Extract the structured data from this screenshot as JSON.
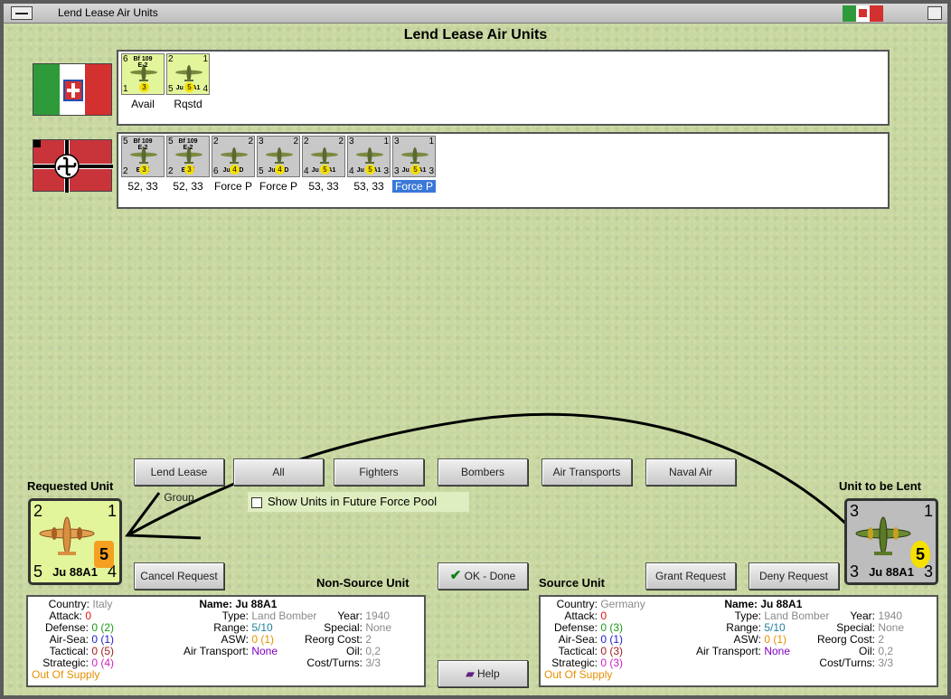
{
  "window": {
    "title": "Lend Lease Air Units"
  },
  "heading": "Lend Lease Air Units",
  "italy_units": [
    {
      "tl": "6",
      "tr": "",
      "bl": "1",
      "br": "",
      "top_name": "Bf 109\nE-2",
      "name": "",
      "str": "3",
      "label": "Avail",
      "bg": "#e3f59b"
    },
    {
      "tl": "2",
      "tr": "1",
      "bl": "5",
      "br": "4",
      "top_name": "",
      "name": "Ju 88A1",
      "str": "5",
      "label": "Rqstd",
      "bg": "#e3f59b"
    }
  ],
  "germany_units": [
    {
      "tl": "5",
      "tr": "",
      "bl": "2",
      "br": "",
      "top_name": "Bf 109\nE-2",
      "name": "Emil",
      "str": "3",
      "label": "52, 33",
      "bg": "#c8c8c8"
    },
    {
      "tl": "5",
      "tr": "",
      "bl": "2",
      "br": "",
      "top_name": "Bf 109\nE-2",
      "name": "Emil",
      "str": "3",
      "label": "52, 33",
      "bg": "#c8c8c8"
    },
    {
      "tl": "2",
      "tr": "2",
      "bl": "6",
      "br": "",
      "top_name": "",
      "name": "Ju 87D",
      "str": "4",
      "label": "Force P",
      "bg": "#c8c8c8"
    },
    {
      "tl": "3",
      "tr": "2",
      "bl": "5",
      "br": "",
      "top_name": "",
      "name": "Ju 87D",
      "str": "4",
      "label": "Force P",
      "bg": "#c8c8c8"
    },
    {
      "tl": "2",
      "tr": "2",
      "bl": "4",
      "br": "",
      "top_name": "",
      "name": "Ju 88A1",
      "str": "5",
      "label": "53, 33",
      "bg": "#c8c8c8"
    },
    {
      "tl": "3",
      "tr": "1",
      "bl": "4",
      "br": "3",
      "top_name": "",
      "name": "Ju 88A1",
      "str": "5",
      "label": "53, 33",
      "bg": "#c8c8c8"
    },
    {
      "tl": "3",
      "tr": "1",
      "bl": "3",
      "br": "3",
      "top_name": "",
      "name": "Ju 88A1",
      "str": "5",
      "label": "Force P",
      "bg": "#c8c8c8",
      "selected": true
    }
  ],
  "buttons": {
    "lend_lease_group": "Lend Lease Group",
    "all": "All",
    "fighters": "Fighters",
    "bombers": "Bombers",
    "air_transports": "Air Transports",
    "naval_air": "Naval Air",
    "cancel_request": "Cancel Request",
    "ok_done": "OK - Done",
    "grant_request": "Grant Request",
    "deny_request": "Deny Request",
    "help": "Help"
  },
  "checkbox": {
    "label": "Show Units in Future Force Pool",
    "checked": false
  },
  "sections": {
    "requested_unit": "Requested Unit",
    "unit_to_be_lent": "Unit to be Lent",
    "non_source_unit": "Non-Source Unit",
    "source_unit": "Source Unit"
  },
  "requested_counter": {
    "tl": "2",
    "tr": "1",
    "bl": "5",
    "br": "4",
    "name": "Ju 88A1",
    "str": "5"
  },
  "lent_counter": {
    "tl": "3",
    "tr": "1",
    "bl": "3",
    "br": "3",
    "name": "Ju 88A1",
    "str": "5"
  },
  "non_source_info": {
    "labels": {
      "country": "Country:",
      "attack": "Attack:",
      "defense": "Defense:",
      "air_sea": "Air-Sea:",
      "tactical": "Tactical:",
      "strategic": "Strategic:",
      "name": "Name:",
      "type": "Type:",
      "range": "Range:",
      "asw": "ASW:",
      "air_transport": "Air Transport:",
      "year": "Year:",
      "special": "Special:",
      "reorg_cost": "Reorg Cost:",
      "oil": "Oil:",
      "cost_turns": "Cost/Turns:"
    },
    "country": "Italy",
    "attack": "0",
    "defense": "0 (2)",
    "air_sea": "0 (1)",
    "tactical": "0 (5)",
    "strategic": "0 (4)",
    "supply": "Out Of Supply",
    "name": "Ju 88A1",
    "type": "Land Bomber",
    "range": "5/10",
    "asw": "0 (1)",
    "air_transport": "None",
    "year": "1940",
    "special": "None",
    "reorg_cost": "2",
    "oil": "0,2",
    "cost_turns": "3/3"
  },
  "source_info": {
    "labels": {
      "country": "Country:",
      "attack": "Attack:",
      "defense": "Defense:",
      "air_sea": "Air-Sea:",
      "tactical": "Tactical:",
      "strategic": "Strategic:",
      "name": "Name:",
      "type": "Type:",
      "range": "Range:",
      "asw": "ASW:",
      "air_transport": "Air Transport:",
      "year": "Year:",
      "special": "Special:",
      "reorg_cost": "Reorg Cost:",
      "oil": "Oil:",
      "cost_turns": "Cost/Turns:"
    },
    "country": "Germany",
    "attack": "0",
    "defense": "0 (3)",
    "air_sea": "0 (1)",
    "tactical": "0 (3)",
    "strategic": "0 (3)",
    "supply": "Out Of Supply",
    "name": "Ju 88A1",
    "type": "Land Bomber",
    "range": "5/10",
    "asw": "0 (1)",
    "air_transport": "None",
    "year": "1940",
    "special": "None",
    "reorg_cost": "2",
    "oil": "0,2",
    "cost_turns": "3/3"
  },
  "colors": {
    "italy_green": "#2f9a3a",
    "italy_red": "#d33030",
    "germany_red": "#c8343a",
    "selection": "#3a78d8"
  }
}
